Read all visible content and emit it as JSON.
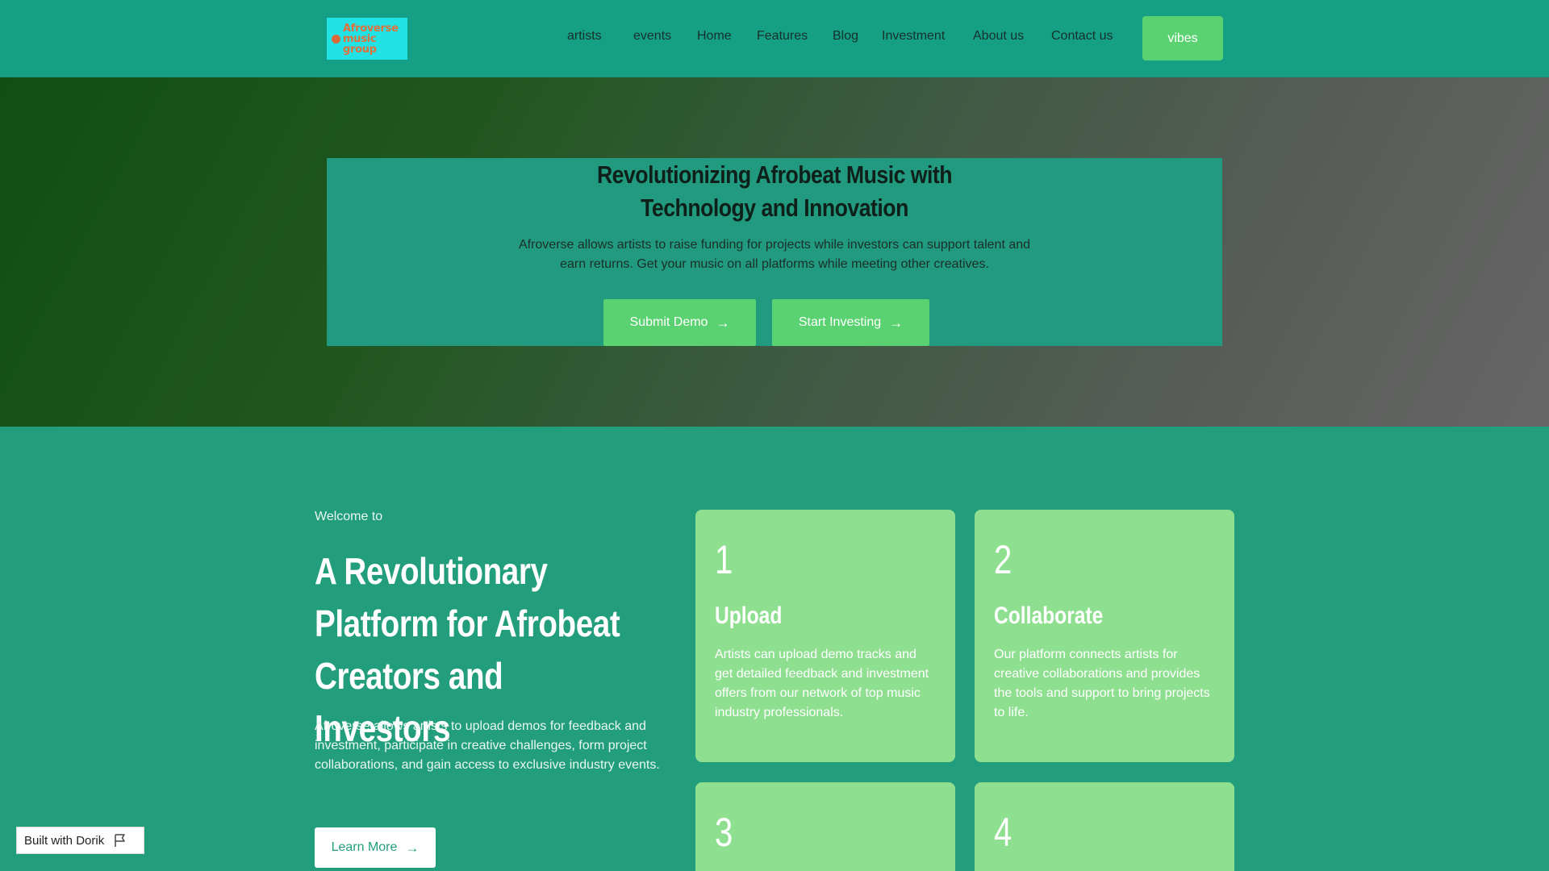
{
  "header": {
    "logo_text": "Afroverse\nmusic\ngroup",
    "nav": [
      "artists",
      "events",
      "Home",
      "Features",
      "Blog",
      "Investment",
      "About us",
      "Contact us"
    ],
    "cta_label": "vibes"
  },
  "hero": {
    "title": "Revolutionizing Afrobeat Music with Technology and Innovation",
    "subtitle": "Afroverse allows artists to raise funding for projects while investors can support talent and earn returns. Get your music on all platforms while meeting other creatives.",
    "buttons": [
      "Submit Demo",
      "Start Investing"
    ]
  },
  "intro": {
    "eyebrow": "Welcome to",
    "title": "A Revolutionary Platform for Afrobeat Creators and Investors",
    "text": "Afroverse allows artists to upload demos for feedback and investment, participate in creative challenges, form project collaborations, and gain access to exclusive industry events.",
    "button": "Learn More"
  },
  "cards": [
    {
      "num": "1",
      "title": "Upload",
      "text": "Artists can upload demo tracks and get detailed feedback and investment offers from our network of top music industry professionals."
    },
    {
      "num": "2",
      "title": "Collaborate",
      "text": "Our platform connects artists for creative collaborations and provides the tools and support to bring projects to life."
    },
    {
      "num": "3"
    },
    {
      "num": "4"
    }
  ],
  "badge": {
    "label": "Built with Dorik"
  },
  "icons": {
    "arrow": "arrow-right-icon",
    "flag": "flag-icon",
    "logo": "logo-mark-icon"
  },
  "colors": {
    "header": "#15a085",
    "accent_green": "#5bd271",
    "card": "#8fdf91",
    "section": "#239e7d",
    "logo_bg": "#22e2e6"
  }
}
